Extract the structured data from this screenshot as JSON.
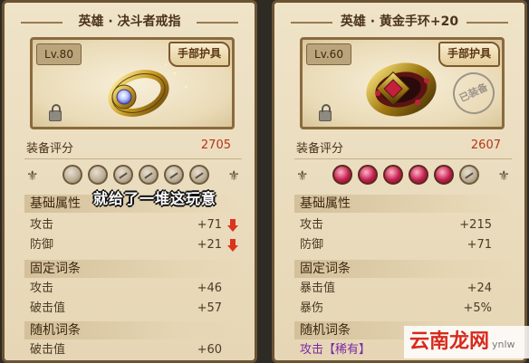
{
  "left": {
    "title": "英雄 · 决斗者戒指",
    "level": "Lv.80",
    "slot": "手部护具",
    "score_label": "装备评分",
    "score": "2705",
    "basic_header": "基础属性",
    "basic": [
      {
        "name": "攻击",
        "value": "+71",
        "arrow": "down"
      },
      {
        "name": "防御",
        "value": "+21",
        "arrow": "down"
      }
    ],
    "fixed_header": "固定词条",
    "fixed": [
      {
        "name": "攻击",
        "value": "+46"
      },
      {
        "name": "破击值",
        "value": "+57"
      }
    ],
    "random_header": "随机词条",
    "random": [
      {
        "name": "破击值",
        "value": "+60"
      }
    ]
  },
  "right": {
    "title": "英雄 · 黄金手环+20",
    "level": "Lv.60",
    "slot": "手部护具",
    "stamp": "已装备",
    "score_label": "装备评分",
    "score": "2607",
    "basic_header": "基础属性",
    "basic": [
      {
        "name": "攻击",
        "value": "+215"
      },
      {
        "name": "防御",
        "value": "+71"
      }
    ],
    "fixed_header": "固定词条",
    "fixed": [
      {
        "name": "暴击值",
        "value": "+24"
      },
      {
        "name": "暴伤",
        "value": "+5%"
      }
    ],
    "random_header": "随机词条",
    "random": [
      {
        "name": "攻击【稀有】",
        "value": ""
      }
    ]
  },
  "caption": "就给了一堆这玩意",
  "watermark": {
    "text": "云南龙网",
    "sub": "ynlw"
  },
  "colors": {
    "score": "#b5361a",
    "rare": "#7a2aa6",
    "arrow_down": "#d8351c"
  }
}
